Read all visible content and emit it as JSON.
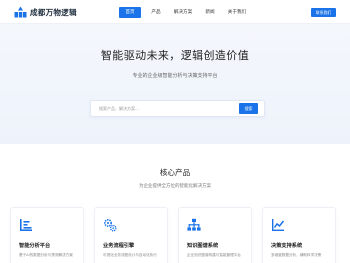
{
  "brand": {
    "name": "成都万物逻辑"
  },
  "nav": {
    "items": [
      {
        "label": "首页",
        "active": true
      },
      {
        "label": "产品",
        "active": false
      },
      {
        "label": "解决方案",
        "active": false
      },
      {
        "label": "新闻",
        "active": false
      },
      {
        "label": "关于我们",
        "active": false
      }
    ],
    "contact_label": "联系我们"
  },
  "hero": {
    "title": "智能驱动未来，逻辑创造价值",
    "subtitle": "专业的企业级智能分析与决策支持平台",
    "search": {
      "placeholder": "搜索产品、解决方案...",
      "button_label": "搜索"
    }
  },
  "products": {
    "title": "核心产品",
    "subtitle": "为企业提供全方位的智能化解决方案",
    "cards": [
      {
        "icon": "list-chart-icon",
        "title": "智能分析平台",
        "desc": "基于AI的数据分析与预测解决方案"
      },
      {
        "icon": "gears-icon",
        "title": "业务流程引擎",
        "desc": "可视化业务流程设计与自动化执行"
      },
      {
        "icon": "sitemap-icon",
        "title": "知识图谱系统",
        "desc": "企业知识图谱构建与智能管理平台"
      },
      {
        "icon": "line-chart-icon",
        "title": "决策支持系统",
        "desc": "多维度数据分析，辅助科学决策"
      }
    ]
  },
  "colors": {
    "accent": "#1a73e8",
    "hero_bg": "#f1f5fb",
    "text": "#222222"
  }
}
